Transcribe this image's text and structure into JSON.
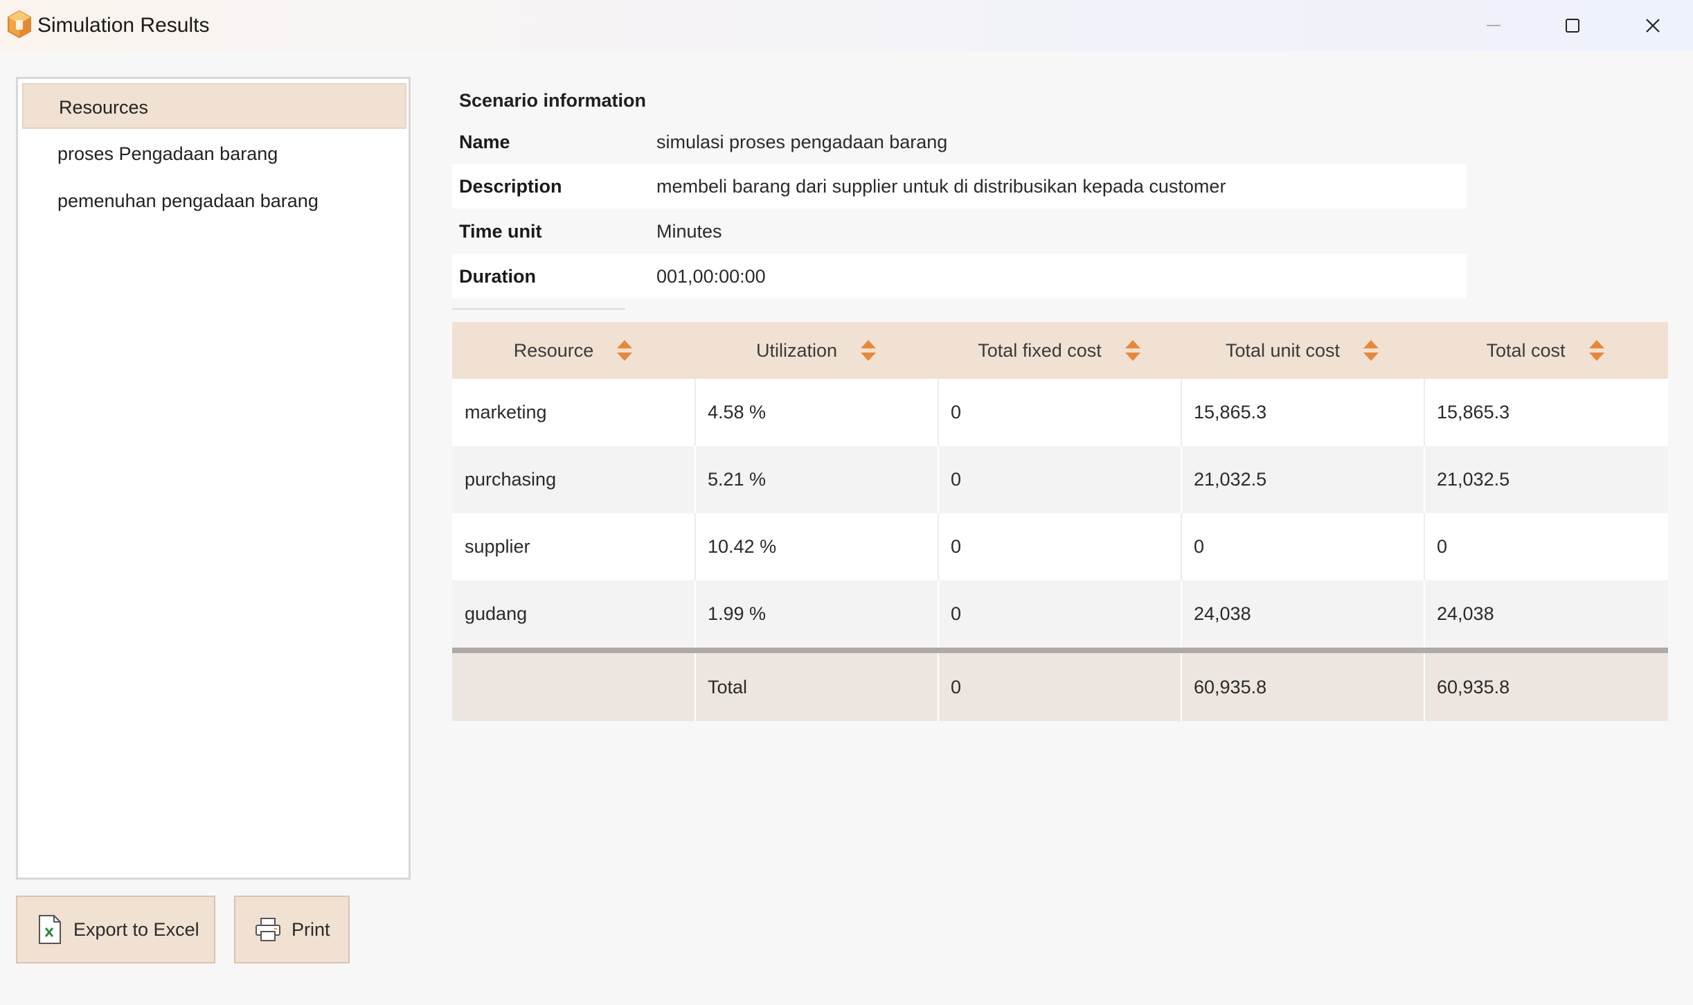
{
  "window": {
    "title": "Simulation Results",
    "app_icon": "cube-icon",
    "controls": [
      "minimize-icon",
      "maximize-icon",
      "close-icon"
    ]
  },
  "sidebar": {
    "items": [
      {
        "label": "Resources",
        "selected": true
      },
      {
        "label": "proses Pengadaan barang",
        "selected": false
      },
      {
        "label": "pemenuhan pengadaan barang",
        "selected": false
      }
    ]
  },
  "actions": {
    "export_label": "Export to Excel",
    "export_icon": "excel-file-icon",
    "print_label": "Print",
    "print_icon": "printer-icon"
  },
  "scenario": {
    "heading": "Scenario information",
    "rows": [
      {
        "key": "Name",
        "value": "simulasi proses pengadaan barang"
      },
      {
        "key": "Description",
        "value": "membeli barang dari supplier untuk di distribusikan kepada customer"
      },
      {
        "key": "Time unit",
        "value": "Minutes"
      },
      {
        "key": "Duration",
        "value": "001,00:00:00"
      }
    ]
  },
  "table": {
    "columns": [
      "Resource",
      "Utilization",
      "Total fixed cost",
      "Total unit cost",
      "Total cost"
    ],
    "rows": [
      [
        "marketing",
        "4.58 %",
        "0",
        "15,865.3",
        "15,865.3"
      ],
      [
        "purchasing",
        "5.21 %",
        "0",
        "21,032.5",
        "21,032.5"
      ],
      [
        "supplier",
        "10.42 %",
        "0",
        "0",
        "0"
      ],
      [
        "gudang",
        "1.99 %",
        "0",
        "24,038",
        "24,038"
      ]
    ],
    "total": [
      "",
      "Total",
      "0",
      "60,935.8",
      "60,935.8"
    ]
  },
  "colors": {
    "accent": "#f1e1d2",
    "sort_arrow": "#e8873a",
    "total_bar": "#b1a8a8"
  }
}
